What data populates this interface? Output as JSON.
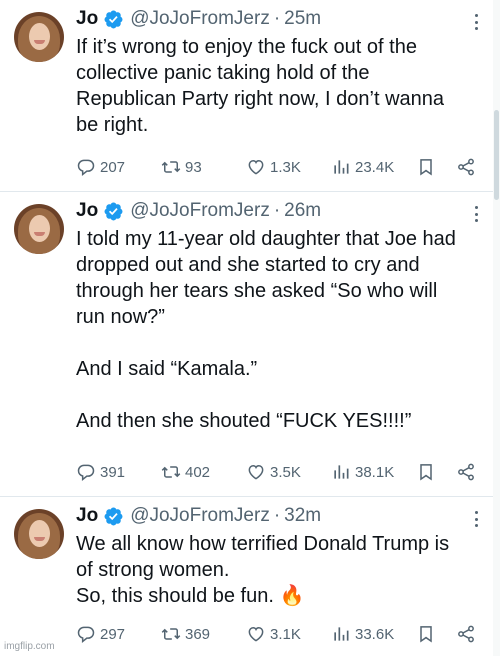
{
  "tweets": [
    {
      "name": "Jo",
      "handle": "@JoJoFromJerz",
      "separator": "·",
      "time": "25m",
      "text": "If it’s wrong to enjoy the fuck out of the\ncollective panic taking hold of the\nRepublican Party right now, I don’t wanna\nbe right.",
      "replies": "207",
      "retweets": "93",
      "likes": "1.3K",
      "views": "23.4K"
    },
    {
      "name": "Jo",
      "handle": "@JoJoFromJerz",
      "separator": "·",
      "time": "26m",
      "text": "I told my 11-year old daughter that Joe had\ndropped out and she started to cry and\nthrough her tears she asked “So who will\nrun now?”\n\nAnd I said “Kamala.”\n\nAnd then she shouted “FUCK YES!!!!”",
      "replies": "391",
      "retweets": "402",
      "likes": "3.5K",
      "views": "38.1K"
    },
    {
      "name": "Jo",
      "handle": "@JoJoFromJerz",
      "separator": "·",
      "time": "32m",
      "text": "We all know how terrified Donald Trump is\nof strong women.\nSo, this should be fun. 🔥",
      "replies": "297",
      "retweets": "369",
      "likes": "3.1K",
      "views": "33.6K"
    }
  ],
  "watermark": "imgflip.com",
  "colors": {
    "verified": "#1d9bf0",
    "muted": "#536471",
    "text": "#0f1419",
    "divider": "#e1e8ed"
  },
  "icons": [
    "verified-badge-icon",
    "more-options-icon",
    "reply-icon",
    "retweet-icon",
    "like-icon",
    "views-icon",
    "bookmark-icon",
    "share-icon"
  ]
}
